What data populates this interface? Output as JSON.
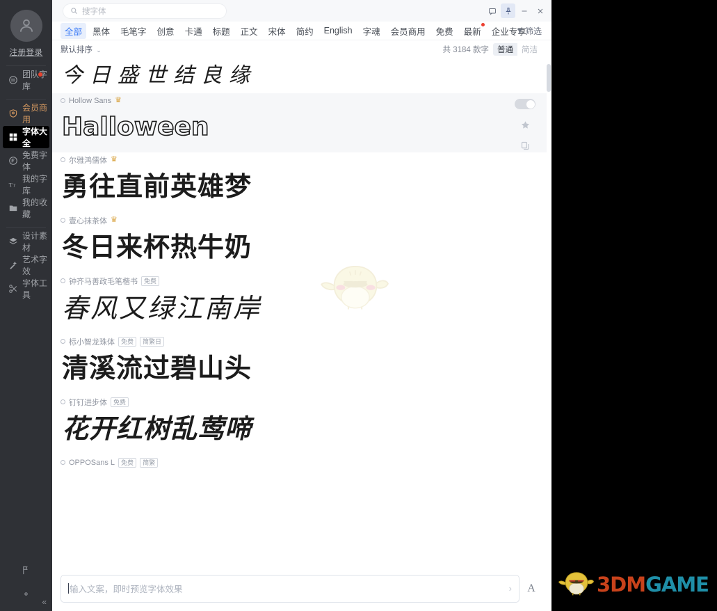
{
  "sidebar": {
    "login_label": "注册登录",
    "items": [
      {
        "label": "团队字库",
        "icon": "team-library-icon",
        "dot": true,
        "style": "normal"
      },
      {
        "label": "会员商用",
        "icon": "vip-shield-icon",
        "dot": false,
        "style": "vip"
      },
      {
        "label": "字体大全",
        "icon": "grid-icon",
        "dot": false,
        "style": "active"
      },
      {
        "label": "免费字体",
        "icon": "free-badge-icon",
        "dot": false,
        "style": "normal"
      },
      {
        "label": "我的字库",
        "icon": "typography-icon",
        "dot": false,
        "style": "normal"
      },
      {
        "label": "我的收藏",
        "icon": "folder-star-icon",
        "dot": false,
        "style": "normal"
      },
      {
        "label": "设计素材",
        "icon": "layers-icon",
        "dot": false,
        "style": "normal"
      },
      {
        "label": "艺术字效",
        "icon": "magic-wand-icon",
        "dot": false,
        "style": "normal"
      },
      {
        "label": "字体工具",
        "icon": "tools-icon",
        "dot": false,
        "style": "normal"
      }
    ],
    "bottom_items": [
      {
        "label": "反馈",
        "icon": "feedback-flag-icon"
      },
      {
        "label": "设置",
        "icon": "gear-icon"
      }
    ],
    "collapse_label": "«"
  },
  "titlebar": {
    "search_placeholder": "搜字体",
    "search_value": "",
    "search_icon": "search-icon",
    "controls": [
      {
        "name": "message-icon",
        "glyph": "message",
        "active": false
      },
      {
        "name": "pin-icon",
        "glyph": "pin",
        "active": true
      },
      {
        "name": "minimize-icon",
        "glyph": "minimize",
        "active": false
      },
      {
        "name": "close-icon",
        "glyph": "close",
        "active": false
      }
    ]
  },
  "tabs": [
    {
      "label": "全部",
      "active": true,
      "dot": false
    },
    {
      "label": "黑体",
      "active": false,
      "dot": false
    },
    {
      "label": "毛笔字",
      "active": false,
      "dot": false
    },
    {
      "label": "创意",
      "active": false,
      "dot": false
    },
    {
      "label": "卡通",
      "active": false,
      "dot": false
    },
    {
      "label": "标题",
      "active": false,
      "dot": false
    },
    {
      "label": "正文",
      "active": false,
      "dot": false
    },
    {
      "label": "宋体",
      "active": false,
      "dot": false
    },
    {
      "label": "简约",
      "active": false,
      "dot": false
    },
    {
      "label": "English",
      "active": false,
      "dot": false
    },
    {
      "label": "字魂",
      "active": false,
      "dot": false
    },
    {
      "label": "会员商用",
      "active": false,
      "dot": false
    },
    {
      "label": "免费",
      "active": false,
      "dot": false
    },
    {
      "label": "最新",
      "active": false,
      "dot": true
    },
    {
      "label": "企业专享",
      "active": false,
      "dot": false
    }
  ],
  "filter": {
    "label": "筛选",
    "icon": "funnel-icon"
  },
  "sortbar": {
    "sort_label": "默认排序",
    "sort_caret": "⌄",
    "count_label": "共 3184 款字",
    "view_modes": [
      {
        "label": "普通",
        "active": true
      },
      {
        "label": "简洁",
        "active": false
      }
    ]
  },
  "font_rows": [
    {
      "name": "",
      "show_head": false,
      "preview": "今日盛世结良缘",
      "style": "hero",
      "vip": false,
      "tags": [],
      "highlighted": false,
      "actions": false
    },
    {
      "name": "Hollow Sans",
      "show_head": true,
      "preview": "Halloween",
      "style": "hollow",
      "vip": true,
      "tags": [],
      "highlighted": true,
      "actions": true
    },
    {
      "name": "尔雅鸿儒体",
      "show_head": true,
      "preview": "勇往直前英雄梦",
      "style": "bold",
      "vip": true,
      "tags": [],
      "highlighted": false,
      "actions": false
    },
    {
      "name": "壹心抹茶体",
      "show_head": true,
      "preview": "冬日来杯热牛奶",
      "style": "bold",
      "vip": true,
      "tags": [],
      "highlighted": false,
      "actions": false
    },
    {
      "name": "钟齐马善政毛笔楷书",
      "show_head": true,
      "preview": "春风又绿江南岸",
      "style": "brush",
      "vip": false,
      "tags": [
        "免费"
      ],
      "highlighted": false,
      "actions": false
    },
    {
      "name": "标小智龙珠体",
      "show_head": true,
      "preview": "清溪流过碧山头",
      "style": "bold",
      "vip": false,
      "tags": [
        "免费",
        "简繁日"
      ],
      "highlighted": false,
      "actions": false
    },
    {
      "name": "钉钉进步体",
      "show_head": true,
      "preview": "花开红树乱莺啼",
      "style": "slant",
      "vip": false,
      "tags": [
        "免费"
      ],
      "highlighted": false,
      "actions": false
    },
    {
      "name": "OPPOSans L",
      "show_head": true,
      "preview": "",
      "style": "bold",
      "vip": false,
      "tags": [
        "免费",
        "简繁"
      ],
      "highlighted": false,
      "actions": false
    }
  ],
  "row_actions": {
    "toggle": "preview-toggle",
    "favorite_icon": "star-icon",
    "copy_icon": "copy-icon"
  },
  "bottombar": {
    "input_placeholder": "输入文案，即时预览字体效果",
    "input_value": "",
    "arrow": "›",
    "font_size_btn": "A"
  },
  "watermark": {
    "part1": "3DM",
    "part2": "GAME",
    "icon": "chick-mascot-icon"
  },
  "colors": {
    "accent": "#3b7bf6",
    "vip": "#d79a61",
    "sidebar_bg": "#2f3136",
    "dot": "#ec3f30",
    "wm_orange": "#c8421b",
    "wm_teal": "#1f8fa8"
  }
}
